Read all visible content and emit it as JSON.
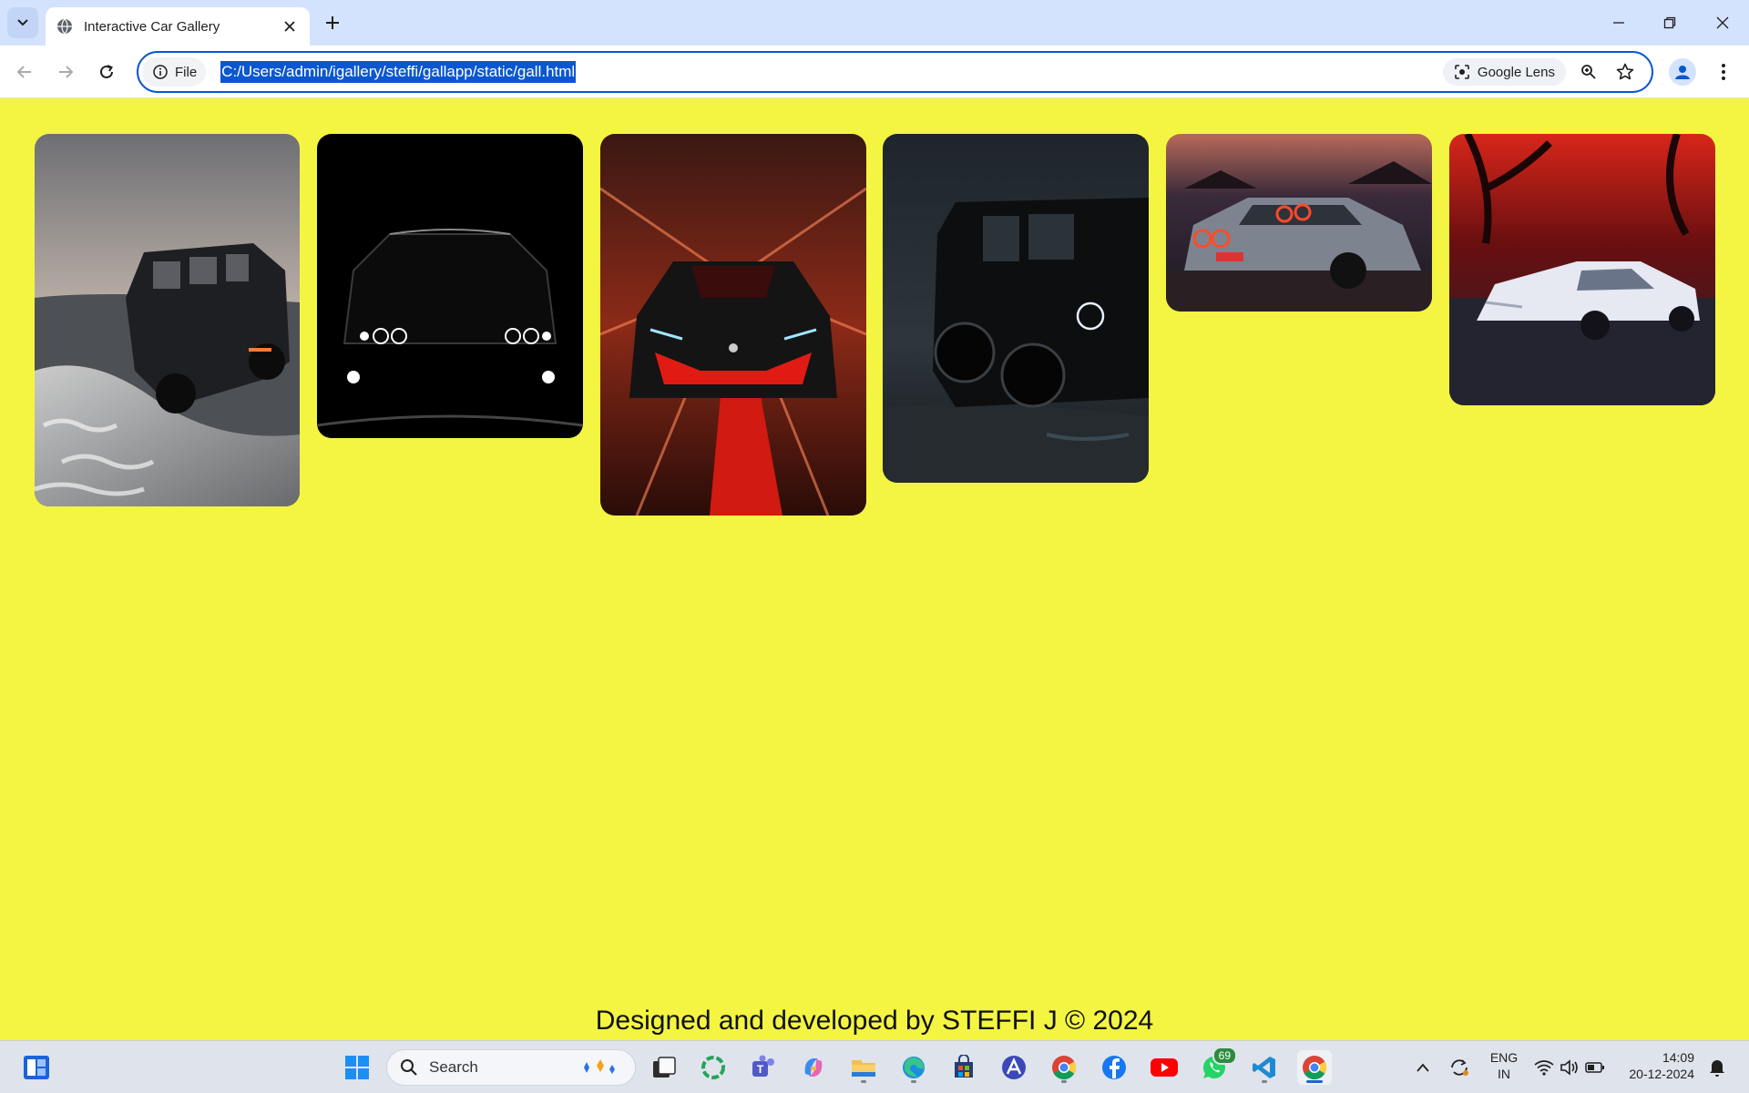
{
  "browser": {
    "tab_title": "Interactive Car Gallery",
    "site_info_label": "File",
    "url": "C:/Users/admin/igallery/steffi/gallapp/static/gall.html",
    "lens_label": "Google Lens"
  },
  "gallery": {
    "background_color": "#f3f542",
    "images": [
      {
        "name": "car-image-offroad-beach"
      },
      {
        "name": "car-image-headlights-dark"
      },
      {
        "name": "car-image-red-supercar"
      },
      {
        "name": "car-image-black-suv"
      },
      {
        "name": "car-image-gtr-night"
      },
      {
        "name": "car-image-white-supra"
      }
    ]
  },
  "footer": {
    "text": "Designed and developed by STEFFI J © 2024"
  },
  "taskbar": {
    "search_placeholder": "Search",
    "whatsapp_badge": "69",
    "language_line1": "ENG",
    "language_line2": "IN",
    "time": "14:09",
    "date": "20-12-2024"
  }
}
